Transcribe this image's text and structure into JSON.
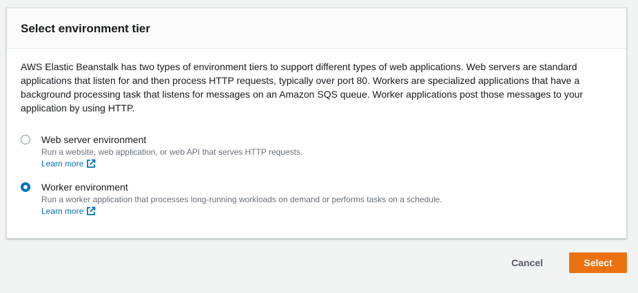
{
  "panel": {
    "title": "Select environment tier",
    "description": "AWS Elastic Beanstalk has two types of environment tiers to support different types of web applications. Web servers are standard applications that listen for and then process HTTP requests, typically over port 80. Workers are specialized applications that have a background processing task that listens for messages on an Amazon SQS queue. Worker applications post those messages to your application by using HTTP."
  },
  "options": [
    {
      "label": "Web server environment",
      "description": "Run a website, web application, or web API that serves HTTP requests.",
      "learn_more": "Learn more",
      "selected": false
    },
    {
      "label": "Worker environment",
      "description": "Run a worker application that processes long-running workloads on demand or performs tasks on a schedule.",
      "learn_more": "Learn more",
      "selected": true
    }
  ],
  "footer": {
    "cancel_label": "Cancel",
    "select_label": "Select"
  },
  "colors": {
    "primary_button": "#ec7211",
    "link": "#0073bb",
    "radio_selected": "#0073bb"
  }
}
